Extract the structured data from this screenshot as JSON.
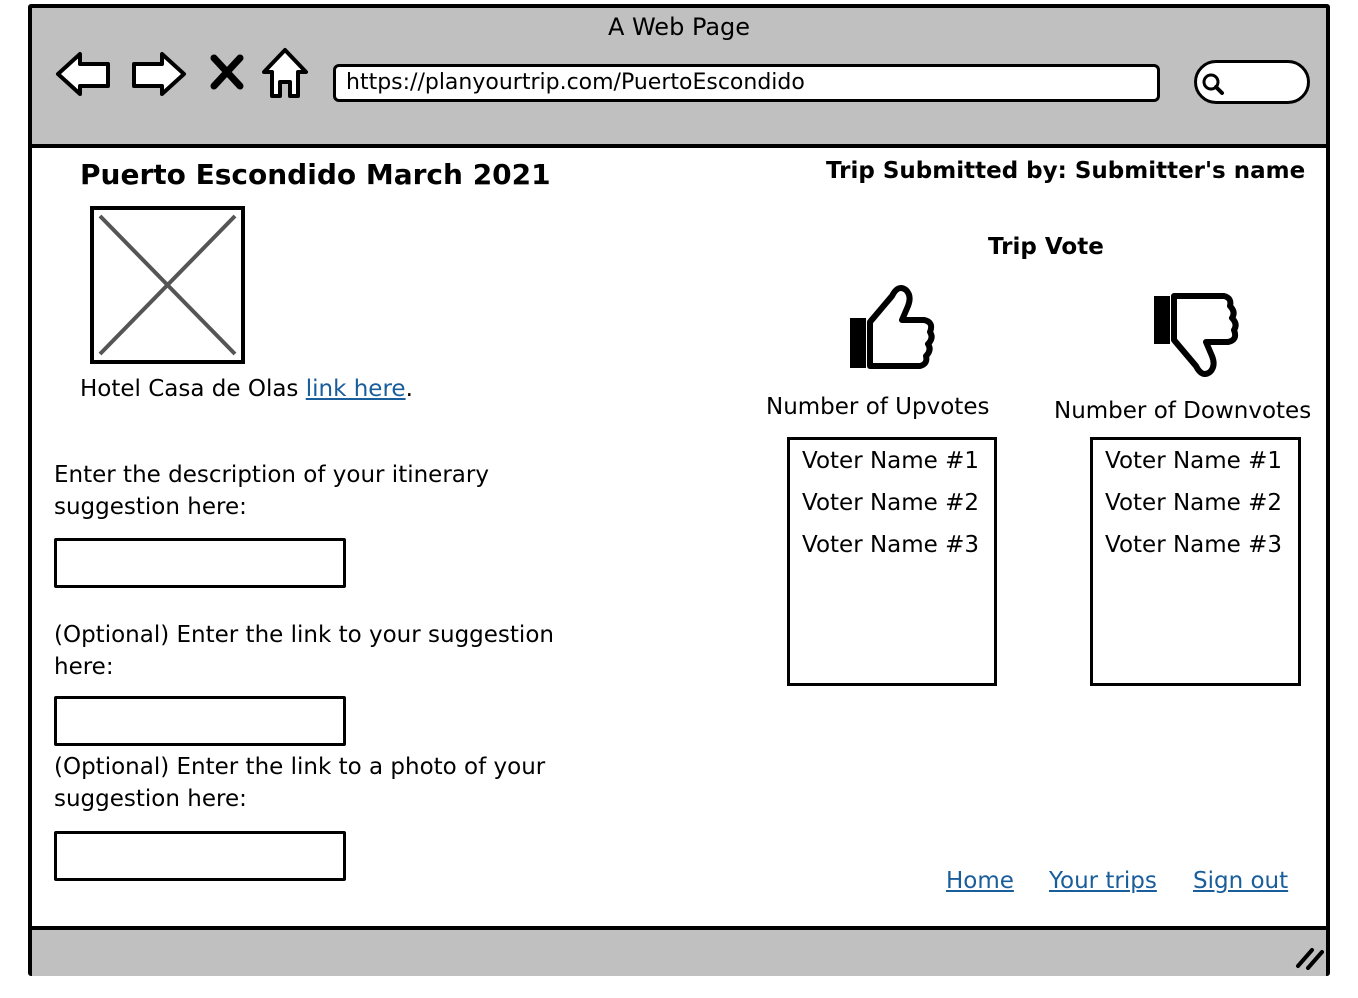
{
  "browser": {
    "window_title": "A Web Page",
    "url": "https://planyourtrip.com/PuertoEscondido",
    "icons": [
      "back-arrow-icon",
      "forward-arrow-icon",
      "close-x-icon",
      "home-icon",
      "search-icon",
      "resize-grip-icon"
    ]
  },
  "page": {
    "title": "Puerto Escondido March 2021",
    "submitted_by": "Trip Submitted by: Submitter's name",
    "image_placeholder_icon": "image-placeholder-icon",
    "hotel": {
      "name": "Hotel Casa de Olas",
      "link_text": "link here",
      "period": "."
    },
    "form": {
      "description_label": "Enter the description of your itinerary suggestion here:",
      "link_label": "(Optional) Enter the link to your suggestion here:",
      "photo_label": "(Optional) Enter the link to a photo of your suggestion here:",
      "description_value": "",
      "link_value": "",
      "photo_value": ""
    },
    "vote": {
      "heading": "Trip Vote",
      "upvotes_label": "Number of Upvotes",
      "downvotes_label": "Number of Downvotes",
      "upvoters": [
        "Voter Name #1",
        "Voter Name #2",
        "Voter Name #3"
      ],
      "downvoters": [
        "Voter Name #1",
        "Voter Name #2",
        "Voter Name #3"
      ]
    },
    "footer_links": {
      "home": "Home",
      "your_trips": "Your trips",
      "sign_out": "Sign out"
    }
  },
  "colors": {
    "chrome_gray": "#c0c0c0",
    "link_blue": "#1a5d9b"
  }
}
